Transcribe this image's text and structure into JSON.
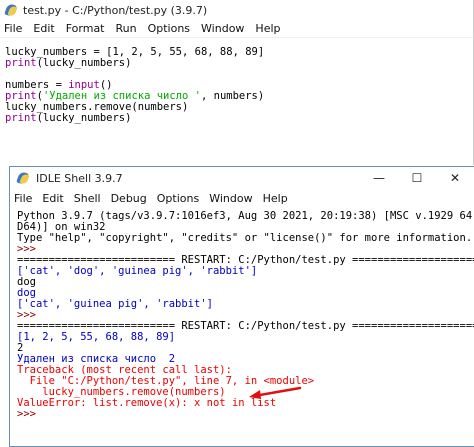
{
  "editor": {
    "title": "test.py - C:/Python/test.py (3.9.7)",
    "menu": [
      "File",
      "Edit",
      "Format",
      "Run",
      "Options",
      "Window",
      "Help"
    ],
    "code": [
      [
        {
          "t": "lucky_numbers = [1, 2, 5, 55, 68, 88, 89]",
          "c": "black"
        }
      ],
      [
        {
          "t": "print",
          "c": "builtin"
        },
        {
          "t": "(lucky_numbers)",
          "c": "black"
        }
      ],
      [
        {
          "t": "",
          "c": "black"
        }
      ],
      [
        {
          "t": "numbers = ",
          "c": "black"
        },
        {
          "t": "input",
          "c": "builtin"
        },
        {
          "t": "()",
          "c": "black"
        }
      ],
      [
        {
          "t": "print",
          "c": "builtin"
        },
        {
          "t": "(",
          "c": "black"
        },
        {
          "t": "'Удален из списка число '",
          "c": "string"
        },
        {
          "t": ", numbers)",
          "c": "black"
        }
      ],
      [
        {
          "t": "lucky_numbers.remove(numbers)",
          "c": "black"
        }
      ],
      [
        {
          "t": "print",
          "c": "builtin"
        },
        {
          "t": "(lucky_numbers)",
          "c": "black"
        }
      ]
    ]
  },
  "shell": {
    "title": "IDLE Shell 3.9.7",
    "controls": {
      "minimize": "—",
      "maximize": "☐",
      "close": "✕"
    },
    "menu": [
      "File",
      "Edit",
      "Shell",
      "Debug",
      "Options",
      "Window",
      "Help"
    ],
    "lines": [
      [
        {
          "t": "Python 3.9.7 (tags/v3.9.7:1016ef3, Aug 30 2021, 20:19:38) [MSC v.1929 64 bit (AM",
          "c": "black"
        }
      ],
      [
        {
          "t": "D64)] on win32",
          "c": "black"
        }
      ],
      [
        {
          "t": "Type \"help\", \"copyright\", \"credits\" or \"license()\" for more information.",
          "c": "black"
        }
      ],
      [
        {
          "t": ">>> ",
          "c": "prompt"
        }
      ],
      [
        {
          "t": "========================= RESTART: C:/Python/test.py =========================",
          "c": "black"
        }
      ],
      [
        {
          "t": "['cat', 'dog', 'guinea pig', 'rabbit']",
          "c": "output"
        }
      ],
      [
        {
          "t": "dog",
          "c": "black"
        }
      ],
      [
        {
          "t": "dog",
          "c": "output"
        }
      ],
      [
        {
          "t": "['cat', 'guinea pig', 'rabbit']",
          "c": "output"
        }
      ],
      [
        {
          "t": ">>> ",
          "c": "prompt"
        }
      ],
      [
        {
          "t": "========================= RESTART: C:/Python/test.py =========================",
          "c": "black"
        }
      ],
      [
        {
          "t": "[1, 2, 5, 55, 68, 88, 89]",
          "c": "output"
        }
      ],
      [
        {
          "t": "2",
          "c": "black"
        }
      ],
      [
        {
          "t": "Удален из списка число  2",
          "c": "output"
        }
      ],
      [
        {
          "t": "Traceback (most recent call last):",
          "c": "error"
        }
      ],
      [
        {
          "t": "  File \"C:/Python/test.py\", line 7, in <module>",
          "c": "error"
        }
      ],
      [
        {
          "t": "    lucky_numbers.remove(numbers)",
          "c": "error"
        }
      ],
      [
        {
          "t": "ValueError: list.remove(x): x not in list",
          "c": "error"
        }
      ],
      [
        {
          "t": ">>> ",
          "c": "prompt"
        }
      ]
    ]
  },
  "annotation_color": "#e01010"
}
